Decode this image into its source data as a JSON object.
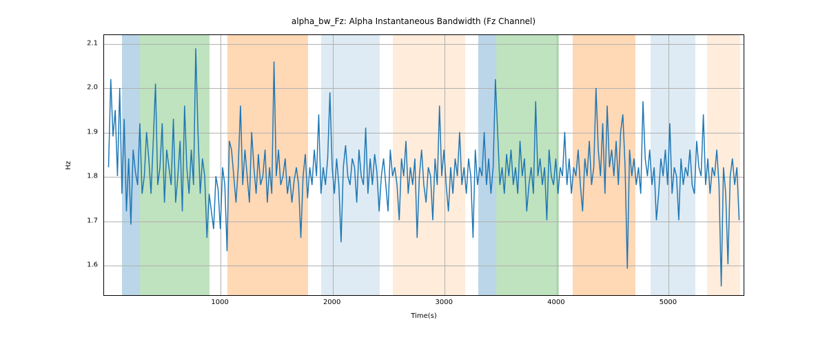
{
  "chart_data": {
    "type": "line",
    "title": "alpha_bw_Fz: Alpha Instantaneous Bandwidth (Fz Channel)",
    "xlabel": "Time(s)",
    "ylabel": "Hz",
    "xlim": [
      -40,
      5680
    ],
    "ylim": [
      1.53,
      2.12
    ],
    "xticks": [
      1000,
      2000,
      3000,
      4000,
      5000
    ],
    "yticks": [
      1.6,
      1.7,
      1.8,
      1.9,
      2.0,
      2.1
    ],
    "grid": true,
    "bands": [
      {
        "x0": 120,
        "x1": 280,
        "color": "#1f77b4",
        "alpha": 0.3
      },
      {
        "x0": 280,
        "x1": 900,
        "color": "#2ca02c",
        "alpha": 0.3
      },
      {
        "x0": 1060,
        "x1": 1780,
        "color": "#ff7f0e",
        "alpha": 0.3
      },
      {
        "x0": 1900,
        "x1": 2420,
        "color": "#1f77b4",
        "alpha": 0.15
      },
      {
        "x0": 2540,
        "x1": 3180,
        "color": "#ff7f0e",
        "alpha": 0.15
      },
      {
        "x0": 3300,
        "x1": 3460,
        "color": "#1f77b4",
        "alpha": 0.3
      },
      {
        "x0": 3460,
        "x1": 4020,
        "color": "#2ca02c",
        "alpha": 0.3
      },
      {
        "x0": 4140,
        "x1": 4700,
        "color": "#ff7f0e",
        "alpha": 0.3
      },
      {
        "x0": 4840,
        "x1": 5240,
        "color": "#1f77b4",
        "alpha": 0.15
      },
      {
        "x0": 5340,
        "x1": 5640,
        "color": "#ff7f0e",
        "alpha": 0.15
      }
    ],
    "line_color": "#1f77b4",
    "series": [
      {
        "name": "alpha_bw_Fz",
        "x_start": 0,
        "x_step": 20,
        "values": [
          1.82,
          2.02,
          1.89,
          1.95,
          1.8,
          2.0,
          1.76,
          1.93,
          1.72,
          1.84,
          1.69,
          1.86,
          1.81,
          1.78,
          1.92,
          1.76,
          1.8,
          1.9,
          1.84,
          1.76,
          1.88,
          2.01,
          1.78,
          1.82,
          1.92,
          1.74,
          1.86,
          1.82,
          1.78,
          1.93,
          1.74,
          1.8,
          1.88,
          1.72,
          1.96,
          1.82,
          1.76,
          1.86,
          1.78,
          2.09,
          1.9,
          1.76,
          1.84,
          1.8,
          1.66,
          1.76,
          1.72,
          1.68,
          1.8,
          1.77,
          1.68,
          1.82,
          1.78,
          1.63,
          1.88,
          1.86,
          1.8,
          1.74,
          1.82,
          1.96,
          1.78,
          1.86,
          1.8,
          1.74,
          1.9,
          1.82,
          1.76,
          1.85,
          1.78,
          1.8,
          1.86,
          1.74,
          1.82,
          1.76,
          2.06,
          1.8,
          1.86,
          1.78,
          1.8,
          1.84,
          1.76,
          1.8,
          1.74,
          1.79,
          1.82,
          1.78,
          1.66,
          1.8,
          1.85,
          1.75,
          1.82,
          1.78,
          1.86,
          1.8,
          1.94,
          1.76,
          1.82,
          1.78,
          1.84,
          1.99,
          1.82,
          1.76,
          1.84,
          1.78,
          1.65,
          1.82,
          1.87,
          1.8,
          1.78,
          1.84,
          1.82,
          1.74,
          1.86,
          1.8,
          1.78,
          1.91,
          1.76,
          1.84,
          1.78,
          1.85,
          1.81,
          1.72,
          1.8,
          1.84,
          1.78,
          1.72,
          1.86,
          1.8,
          1.82,
          1.78,
          1.7,
          1.84,
          1.8,
          1.88,
          1.76,
          1.82,
          1.78,
          1.84,
          1.66,
          1.8,
          1.86,
          1.78,
          1.74,
          1.82,
          1.8,
          1.7,
          1.84,
          1.78,
          1.96,
          1.8,
          1.86,
          1.78,
          1.72,
          1.82,
          1.76,
          1.84,
          1.8,
          1.9,
          1.78,
          1.82,
          1.76,
          1.84,
          1.8,
          1.66,
          1.86,
          1.78,
          1.82,
          1.8,
          1.9,
          1.78,
          1.84,
          1.76,
          1.82,
          2.02,
          1.9,
          1.78,
          1.82,
          1.76,
          1.85,
          1.8,
          1.86,
          1.78,
          1.82,
          1.76,
          1.88,
          1.8,
          1.84,
          1.72,
          1.78,
          1.82,
          1.76,
          1.97,
          1.8,
          1.84,
          1.78,
          1.82,
          1.7,
          1.86,
          1.8,
          1.78,
          1.84,
          1.76,
          1.82,
          1.8,
          1.9,
          1.78,
          1.84,
          1.76,
          1.82,
          1.8,
          1.86,
          1.78,
          1.72,
          1.84,
          1.8,
          1.88,
          1.78,
          1.82,
          2.0,
          1.86,
          1.8,
          1.92,
          1.76,
          1.96,
          1.82,
          1.86,
          1.8,
          1.88,
          1.78,
          1.9,
          1.94,
          1.82,
          1.59,
          1.86,
          1.8,
          1.84,
          1.78,
          1.82,
          1.76,
          1.97,
          1.84,
          1.8,
          1.86,
          1.78,
          1.82,
          1.7,
          1.76,
          1.84,
          1.8,
          1.86,
          1.78,
          1.92,
          1.76,
          1.82,
          1.8,
          1.7,
          1.84,
          1.78,
          1.82,
          1.8,
          1.86,
          1.78,
          1.76,
          1.88,
          1.82,
          1.8,
          1.94,
          1.78,
          1.84,
          1.76,
          1.82,
          1.8,
          1.86,
          1.78,
          1.55,
          1.82,
          1.76,
          1.6,
          1.8,
          1.84,
          1.78,
          1.82,
          1.7
        ]
      }
    ]
  }
}
